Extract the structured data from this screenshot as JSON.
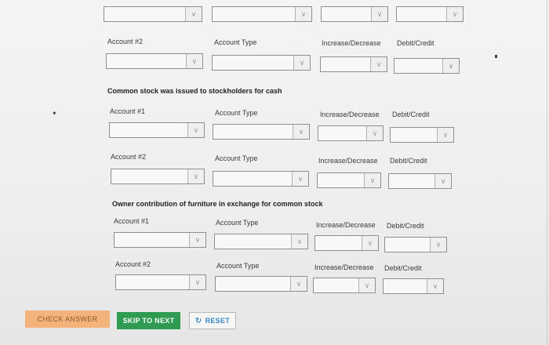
{
  "labels": {
    "account1": "Account #1",
    "account2": "Account #2",
    "account_type": "Account Type",
    "increase_decrease": "Increase/Decrease",
    "debit_credit": "Debit/Credit"
  },
  "questions": {
    "common_stock": "Common stock was issued to stockholders for cash",
    "furniture": "Owner contribution of furniture in exchange for common stock"
  },
  "buttons": {
    "check_answer": "CHECK ANSWER",
    "skip_to_next": "SKIP TO NEXT",
    "reset": "RESET"
  },
  "icons": {
    "dropdown": "chevron-down-icon",
    "reset": "refresh-icon",
    "pointer": "star-marker-icon"
  },
  "colors": {
    "check_answer_bg": "#f4b37a",
    "skip_bg": "#2f9a52",
    "reset_text": "#3c88c5"
  }
}
